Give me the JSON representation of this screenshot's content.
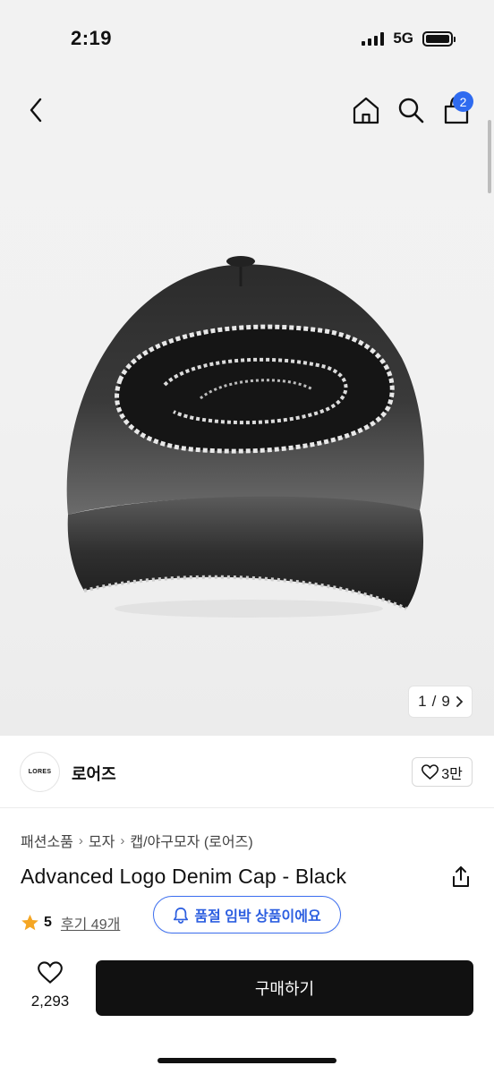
{
  "status_bar": {
    "time": "2:19",
    "network": "5G"
  },
  "nav": {
    "cart_count": "2"
  },
  "gallery": {
    "current": "1",
    "separator": "/",
    "total": "9"
  },
  "brand": {
    "logo_text": "LORES",
    "name": "로어즈",
    "like_count": "3만"
  },
  "breadcrumb": [
    "패션소품",
    "모자",
    "캡/야구모자 (로어즈)"
  ],
  "product": {
    "title": "Advanced Logo Denim Cap - Black"
  },
  "rating": {
    "score": "5",
    "review_link": "후기 49개"
  },
  "restock_notice": {
    "label": "품절 임박 상품이에요"
  },
  "bottom_bar": {
    "wish_count": "2,293",
    "buy_label": "구매하기"
  },
  "colors": {
    "accent": "#2f6bf0",
    "buy_button": "#111111",
    "star": "#f5a623"
  }
}
